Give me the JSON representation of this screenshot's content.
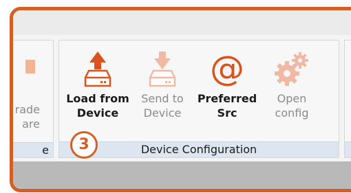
{
  "ribbon": {
    "partial_group": {
      "button_line1": "rade",
      "button_line2": "are",
      "label": "e"
    },
    "device_configuration": {
      "label": "Device Configuration",
      "buttons": [
        {
          "line1": "Load from",
          "line2": "Device",
          "icon": "load-from-device-icon",
          "enabled": true
        },
        {
          "line1": "Send to",
          "line2": "Device",
          "icon": "send-to-device-icon",
          "enabled": false
        },
        {
          "line1": "Preferred",
          "line2": "Src",
          "icon": "at-sign-icon",
          "enabled": true
        },
        {
          "line1": "Open",
          "line2": "config",
          "icon": "gears-icon",
          "enabled": false
        }
      ]
    }
  },
  "annotation": {
    "step_number": "3"
  },
  "colors": {
    "accent": "#d35f24",
    "icon_enabled": "#d9531e",
    "icon_disabled": "#f0b9a3",
    "group_label_bg": "#dde6f0",
    "status_bar": "#b9b9b9"
  }
}
